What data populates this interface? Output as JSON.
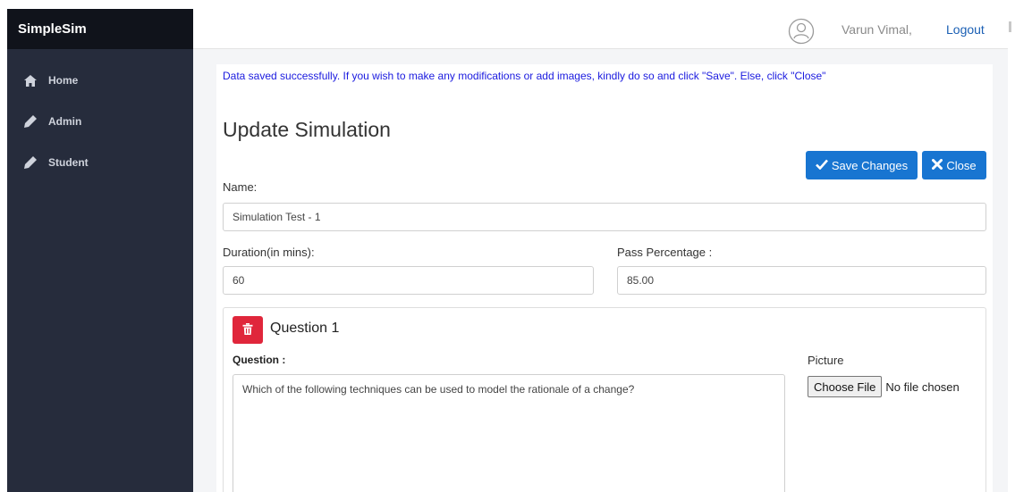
{
  "app": {
    "brand": "SimpleSim"
  },
  "sidebar": {
    "items": [
      {
        "label": "Home",
        "icon": "home-icon"
      },
      {
        "label": "Admin",
        "icon": "pencil-icon"
      },
      {
        "label": "Student",
        "icon": "pencil-icon"
      }
    ]
  },
  "header": {
    "user_name": "Varun Vimal,",
    "logout_label": "Logout"
  },
  "alert": {
    "message": "Data saved successfully. If you wish to make any modifications or add images, kindly do so and click \"Save\". Else, click \"Close\""
  },
  "page": {
    "title": "Update Simulation"
  },
  "toolbar": {
    "save_label": "Save Changes",
    "close_label": "Close"
  },
  "form": {
    "name_label": "Name:",
    "name_value": "Simulation Test - 1",
    "duration_label": "Duration(in mins):",
    "duration_value": "60",
    "pass_label": "Pass Percentage :",
    "pass_value": "85.00"
  },
  "question": {
    "title": "Question 1",
    "question_label": "Question :",
    "question_text": "Which of the following techniques can be used to model the rationale of a change?",
    "picture_label": "Picture",
    "file_button_label": "Choose File",
    "file_status": "No file chosen"
  },
  "colors": {
    "sidebar_bg": "#262c3c",
    "brand_bg": "#10131b",
    "primary": "#1875d1",
    "danger": "#e0263b",
    "alert_text": "#1a1adf"
  }
}
